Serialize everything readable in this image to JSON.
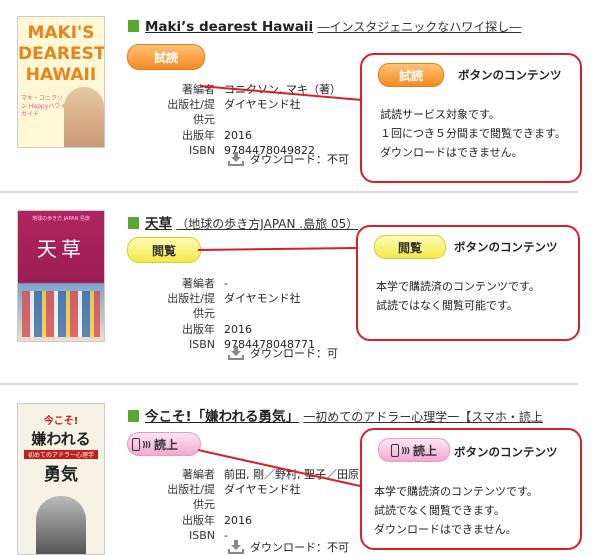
{
  "labels": {
    "author": "著編者",
    "publisher": "出版社/提供元",
    "year": "出版年",
    "isbn": "ISBN"
  },
  "books": [
    {
      "title": "Maki’s dearest Hawaii",
      "subtitle": "―インスタジェニックなハワイ探し―",
      "cover_text": [
        "MAKI'S",
        "DEAREST",
        "HAWAII"
      ],
      "cover_sub": "マキ・コニクソン Happyハワイガイド",
      "button": "試読",
      "author": "コニクソン, マキ（著）",
      "publisher": "ダイヤモンド社",
      "year": "2016",
      "isbn": "9784478049822",
      "download": "ダウンロード：不可",
      "callout": {
        "button": "試読",
        "title": "ボタンのコンテンツ",
        "lines": [
          "試読サービス対象です。",
          "１回につき５分間まで閲覧できます。",
          "ダウンロードはできません。"
        ]
      }
    },
    {
      "title": "天草",
      "subtitle": "（地球の歩き方JAPAN .島旅 05）",
      "cover_text": [
        "天",
        "草"
      ],
      "cover_sub": "地球の歩き方 JAPAN 島旅",
      "button": "閲覧",
      "author": "-",
      "publisher": "ダイヤモンド社",
      "year": "2016",
      "isbn": "9784478048771",
      "download": "ダウンロード：可",
      "callout": {
        "button": "閲覧",
        "title": "ボタンのコンテンツ",
        "lines": [
          "本学で購読済のコンテンツです。",
          "試読ではなく閲覧可能です。"
        ]
      }
    },
    {
      "title": "今こそ!「嫌われる勇気」",
      "subtitle": "一初めてのアドラー心理学一【スマホ・読上",
      "cover_text": [
        "今こそ!",
        "嫌われる",
        "勇気"
      ],
      "cover_sub": "初めてのアドラー心理学",
      "button": "読上",
      "author": "前田, 剛／野村, 聖子／田原, 寛（著）",
      "publisher": "ダイヤモンド社",
      "year": "2016",
      "isbn": "-",
      "download": "ダウンロード：不可",
      "callout": {
        "button": "読上",
        "title": "ボタンのコンテンツ",
        "lines": [
          "本学で購読済のコンテンツです。",
          "試読でなく閲覧できます。",
          "ダウンロードはできません。"
        ]
      }
    }
  ]
}
